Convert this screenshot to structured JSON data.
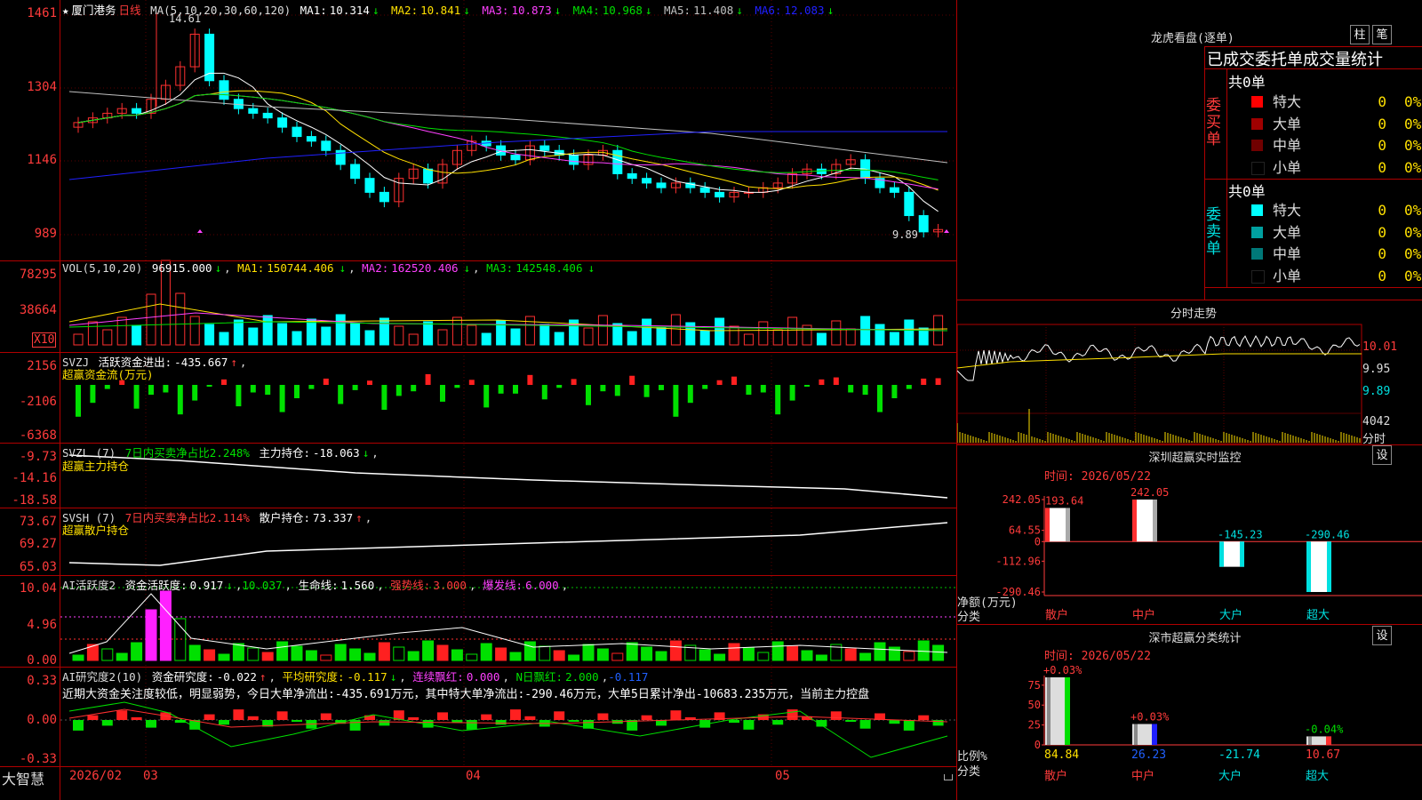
{
  "stock": {
    "name": "厦门港务",
    "period": "日线",
    "star": "★"
  },
  "main": {
    "ma_label": "MA(5,10,20,30,60,120)",
    "ma": [
      {
        "label": "MA1:",
        "value": "10.314",
        "color": "#ffffff"
      },
      {
        "label": "MA2:",
        "value": "10.841",
        "color": "#ffe000"
      },
      {
        "label": "MA3:",
        "value": "10.873",
        "color": "#ff40ff"
      },
      {
        "label": "MA4:",
        "value": "10.968",
        "color": "#00e000"
      },
      {
        "label": "MA5:",
        "value": "11.408",
        "color": "#c0c0c0"
      },
      {
        "label": "MA6:",
        "value": "12.083",
        "color": "#2020ff"
      }
    ],
    "arrow": "↓",
    "y_ticks": [
      "1461",
      "1304",
      "1146",
      "989"
    ],
    "high_label": "14.61",
    "low_label": "9.89"
  },
  "vol": {
    "title": "VOL(5,10,20)",
    "value": "96915.000",
    "ma": [
      {
        "label": "MA1:",
        "value": "150744.406",
        "color": "#ffe000"
      },
      {
        "label": "MA2:",
        "value": "162520.406",
        "color": "#ff40ff"
      },
      {
        "label": "MA3:",
        "value": "142548.406",
        "color": "#00e000"
      }
    ],
    "y_ticks": [
      "78295",
      "38664"
    ],
    "unit": "X10"
  },
  "svzj": {
    "title": "SVZJ",
    "field": "活跃资金进出:",
    "value": "-435.667",
    "arrow": "↑",
    "sub": "超赢资金流(万元)",
    "y_ticks": [
      "2156",
      "-2106",
      "-6368"
    ]
  },
  "svzl": {
    "title": "SVZL (7)",
    "field1": "7日内买卖净占比2.248%",
    "field2": "主力持仓:",
    "value": "-18.063",
    "arrow": "↓",
    "sub": "超赢主力持仓",
    "y_ticks": [
      "-9.73",
      "-14.16",
      "-18.58"
    ]
  },
  "svsh": {
    "title": "SVSH (7)",
    "field1": "7日内买卖净占比2.114%",
    "field2": "散户持仓:",
    "value": "73.337",
    "arrow": "↑",
    "sub": "超赢散户持仓",
    "y_ticks": [
      "73.67",
      "69.27",
      "65.03"
    ]
  },
  "ai1": {
    "title": "AI活跃度2",
    "f1": "资金活跃度:",
    "v1": "0.917",
    "a1": "↓",
    "v2": "10.037",
    "f3": "生命线:",
    "v3": "1.560",
    "f4": "强势线:",
    "v4": "3.000",
    "f5": "爆发线:",
    "v5": "6.000",
    "y_ticks": [
      "10.04",
      "4.96",
      "0.00"
    ]
  },
  "ai2": {
    "title": "AI研究度2(10)",
    "f1": "资金研究度:",
    "v1": "-0.022",
    "a1": "↑",
    "f2": "平均研究度:",
    "v2": "-0.117",
    "a2": "↓",
    "f3": "连续飘红:",
    "v3": "0.000",
    "f4": "N日飘红:",
    "v4": "2.000",
    "v5": "-0.117",
    "comment": "近期大资金关注度较低，明显弱势，今日大单净流出:-435.691万元，其中特大单净流出:-290.46万元，大单5日累计净出-10683.235万元，当前主力控盘",
    "y_ticks": [
      "0.33",
      "0.00",
      "-0.33"
    ]
  },
  "xaxis": {
    "brand": "大智慧",
    "labels": [
      "2026/02",
      "03",
      "04",
      "05"
    ]
  },
  "orderbook": {
    "title": "龙虎看盘(逐单)",
    "btn1": "柱",
    "btn2": "笔",
    "header": "已成交委托单成交量统计",
    "buy": {
      "side": "委买单",
      "total": "共0单",
      "rows": [
        {
          "label": "特大",
          "qty": "0",
          "pct": "0%",
          "color": "#ff0000"
        },
        {
          "label": "大单",
          "qty": "0",
          "pct": "0%",
          "color": "#a00000"
        },
        {
          "label": "中单",
          "qty": "0",
          "pct": "0%",
          "color": "#700000"
        },
        {
          "label": "小单",
          "qty": "0",
          "pct": "0%",
          "color": "#000000"
        }
      ]
    },
    "sell": {
      "side": "委卖单",
      "total": "共0单",
      "rows": [
        {
          "label": "特大",
          "qty": "0",
          "pct": "0%",
          "color": "#00ffff"
        },
        {
          "label": "大单",
          "qty": "0",
          "pct": "0%",
          "color": "#00a0a0"
        },
        {
          "label": "中单",
          "qty": "0",
          "pct": "0%",
          "color": "#007878"
        },
        {
          "label": "小单",
          "qty": "0",
          "pct": "0%",
          "color": "#000000"
        }
      ]
    }
  },
  "minute": {
    "title": "分时走势",
    "price_ticks": [
      "10.01",
      "9.95",
      "9.89"
    ],
    "vol_tick": "4042",
    "vol_unit": "分时"
  },
  "monitor": {
    "title": "深圳超赢实时监控",
    "btn": "设",
    "time": "时间: 2026/05/22",
    "y_ticks": [
      "242.05",
      "64.55",
      "0",
      "-112.96",
      "-290.46"
    ],
    "ylabel1": "净额(万元)",
    "ylabel2": "分类",
    "chart_data": {
      "type": "bar",
      "categories": [
        "散户",
        "中户",
        "大户",
        "超大"
      ],
      "values": [
        193.64,
        242.05,
        -145.23,
        -290.46
      ],
      "ylim": [
        -290.46,
        242.05
      ]
    }
  },
  "classify": {
    "title": "深市超赢分类统计",
    "btn": "设",
    "time": "时间: 2026/05/22",
    "y_ticks": [
      "75",
      "50",
      "25",
      "0"
    ],
    "ylabel1": "比例%",
    "ylabel2": "分类",
    "changes": [
      "+0.03%",
      "+0.03%",
      "-0.04%"
    ],
    "chart_data": {
      "type": "bar",
      "categories": [
        "散户",
        "中户",
        "大户",
        "超大"
      ],
      "values": [
        84.84,
        26.23,
        -21.74,
        10.67
      ],
      "ylim": [
        0,
        84.84
      ]
    }
  }
}
